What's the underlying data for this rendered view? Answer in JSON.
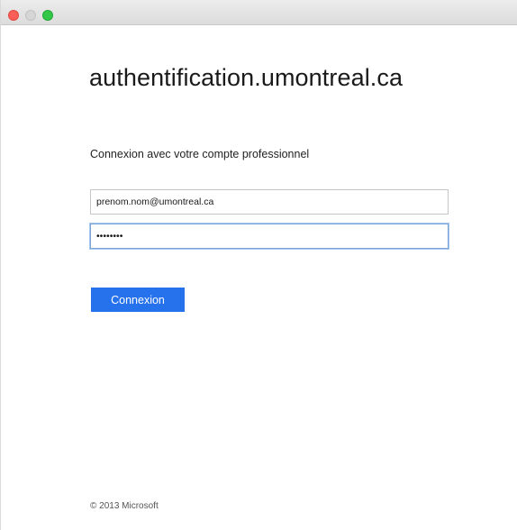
{
  "window": {
    "controls": {
      "close": "close-control",
      "minimize": "minimize-control",
      "maximize": "maximize-control"
    }
  },
  "page": {
    "site_title": "authentification.umontreal.ca",
    "subtitle": "Connexion avec votre compte professionnel",
    "email": {
      "value": "prenom.nom@umontreal.ca"
    },
    "password": {
      "value": "••••••••"
    },
    "login_button_label": "Connexion",
    "footer": "© 2013 Microsoft"
  },
  "colors": {
    "accent": "#2672ec",
    "close": "#fc5f57",
    "maximize": "#33c748"
  }
}
